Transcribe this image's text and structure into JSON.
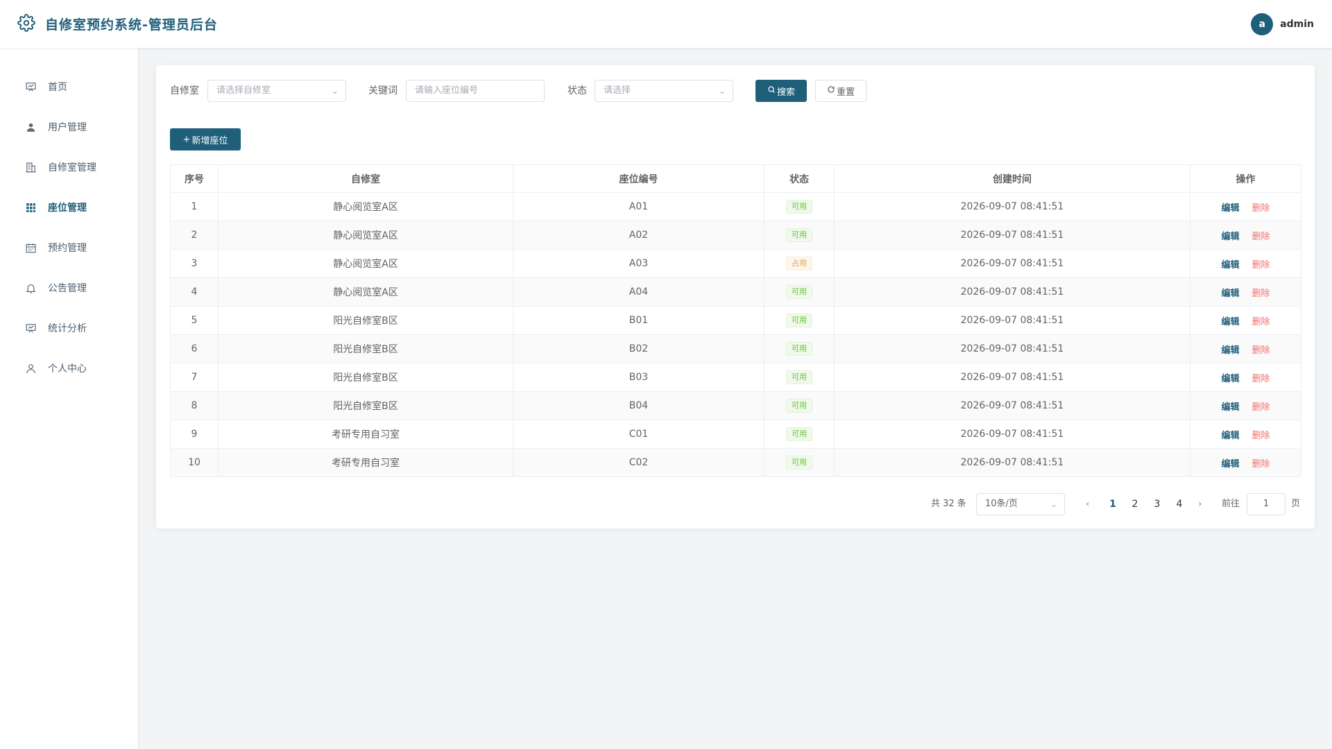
{
  "header": {
    "title": "自修室预约系统-管理员后台",
    "avatar_letter": "a",
    "username": "admin",
    "logo_icon": "gear-icon"
  },
  "sidebar": {
    "items": [
      {
        "label": "首页",
        "icon": "presentation-chart-icon",
        "active": false
      },
      {
        "label": "用户管理",
        "icon": "user-icon",
        "active": false
      },
      {
        "label": "自修室管理",
        "icon": "building-icon",
        "active": false
      },
      {
        "label": "座位管理",
        "icon": "grid-icon",
        "active": true
      },
      {
        "label": "预约管理",
        "icon": "calendar-icon",
        "active": false
      },
      {
        "label": "公告管理",
        "icon": "bell-icon",
        "active": false
      },
      {
        "label": "统计分析",
        "icon": "presentation-chart-icon",
        "active": false
      },
      {
        "label": "个人中心",
        "icon": "user-outline-icon",
        "active": false
      }
    ]
  },
  "filters": {
    "room_label": "自修室",
    "room_placeholder": "请选择自修室",
    "keyword_label": "关键词",
    "keyword_placeholder": "请输入座位编号",
    "status_label": "状态",
    "status_placeholder": "请选择",
    "search_label": "搜索",
    "reset_label": "重置"
  },
  "toolbar": {
    "add_label": "新增座位"
  },
  "table": {
    "headers": [
      "序号",
      "自修室",
      "座位编号",
      "状态",
      "创建时间",
      "操作"
    ],
    "edit_label": "编辑",
    "delete_label": "删除",
    "rows": [
      {
        "index": "1",
        "room": "静心阅览室A区",
        "seat": "A01",
        "status": "可用",
        "created": "2026-09-07 08:41:51"
      },
      {
        "index": "2",
        "room": "静心阅览室A区",
        "seat": "A02",
        "status": "可用",
        "created": "2026-09-07 08:41:51"
      },
      {
        "index": "3",
        "room": "静心阅览室A区",
        "seat": "A03",
        "status": "占用",
        "created": "2026-09-07 08:41:51"
      },
      {
        "index": "4",
        "room": "静心阅览室A区",
        "seat": "A04",
        "status": "可用",
        "created": "2026-09-07 08:41:51"
      },
      {
        "index": "5",
        "room": "阳光自修室B区",
        "seat": "B01",
        "status": "可用",
        "created": "2026-09-07 08:41:51"
      },
      {
        "index": "6",
        "room": "阳光自修室B区",
        "seat": "B02",
        "status": "可用",
        "created": "2026-09-07 08:41:51"
      },
      {
        "index": "7",
        "room": "阳光自修室B区",
        "seat": "B03",
        "status": "可用",
        "created": "2026-09-07 08:41:51"
      },
      {
        "index": "8",
        "room": "阳光自修室B区",
        "seat": "B04",
        "status": "可用",
        "created": "2026-09-07 08:41:51"
      },
      {
        "index": "9",
        "room": "考研专用自习室",
        "seat": "C01",
        "status": "可用",
        "created": "2026-09-07 08:41:51"
      },
      {
        "index": "10",
        "room": "考研专用自习室",
        "seat": "C02",
        "status": "可用",
        "created": "2026-09-07 08:41:51"
      }
    ]
  },
  "pagination": {
    "total": "共 32 条",
    "page_size": "10条/页",
    "pages": [
      "1",
      "2",
      "3",
      "4"
    ],
    "current": "1",
    "goto_label": "前往",
    "goto_value": "1",
    "goto_suffix": "页"
  },
  "colors": {
    "primary": "#1f5f7a",
    "available": "#67c23a",
    "occupied": "#e6a23c",
    "danger": "#f56c6c"
  }
}
